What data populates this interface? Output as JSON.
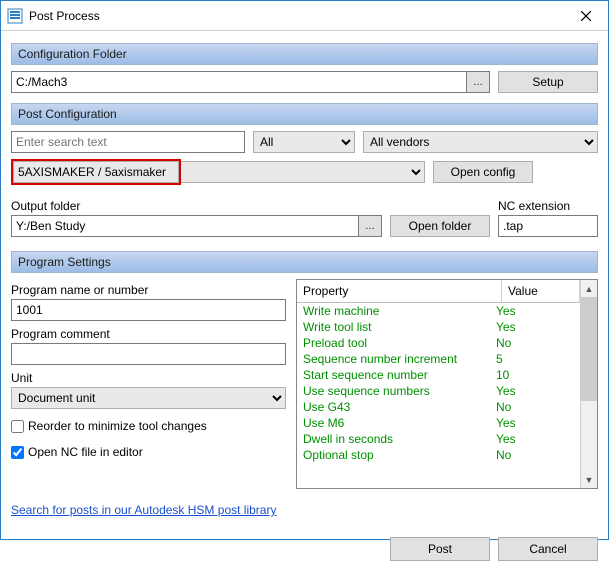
{
  "window": {
    "title": "Post Process"
  },
  "sections": {
    "config_folder": "Configuration Folder",
    "post_config": "Post Configuration",
    "program_settings": "Program Settings"
  },
  "config_folder": {
    "path": "C:/Mach3",
    "setup_label": "Setup"
  },
  "post_config": {
    "search_placeholder": "Enter search text",
    "filter_all": "All",
    "vendor_all": "All vendors",
    "post_selected": " 5AXISMAKER / 5axismaker",
    "open_config_label": "Open config"
  },
  "output": {
    "folder_label": "Output folder",
    "folder": "Y:/Ben Study",
    "open_folder_label": "Open folder",
    "nc_ext_label": "NC extension",
    "nc_ext": ".tap"
  },
  "program": {
    "name_label": "Program name or number",
    "name": "1001",
    "comment_label": "Program comment",
    "comment": "",
    "unit_label": "Unit",
    "unit": "Document unit",
    "reorder_label": "Reorder to minimize tool changes",
    "reorder_checked": false,
    "open_nc_label": "Open NC file in editor",
    "open_nc_checked": true
  },
  "props": {
    "col_property": "Property",
    "col_value": "Value",
    "rows": [
      {
        "name": "Write machine",
        "value": "Yes"
      },
      {
        "name": "Write tool list",
        "value": "Yes"
      },
      {
        "name": "Preload tool",
        "value": "No"
      },
      {
        "name": "Sequence number increment",
        "value": "5"
      },
      {
        "name": "Start sequence number",
        "value": "10"
      },
      {
        "name": "Use sequence numbers",
        "value": "Yes"
      },
      {
        "name": "Use G43",
        "value": "No"
      },
      {
        "name": "Use M6",
        "value": "Yes"
      },
      {
        "name": "Dwell in seconds",
        "value": "Yes"
      },
      {
        "name": "Optional stop",
        "value": "No"
      }
    ]
  },
  "footer": {
    "library_link": "Search for posts in our Autodesk HSM post library",
    "post_label": "Post",
    "cancel_label": "Cancel"
  }
}
